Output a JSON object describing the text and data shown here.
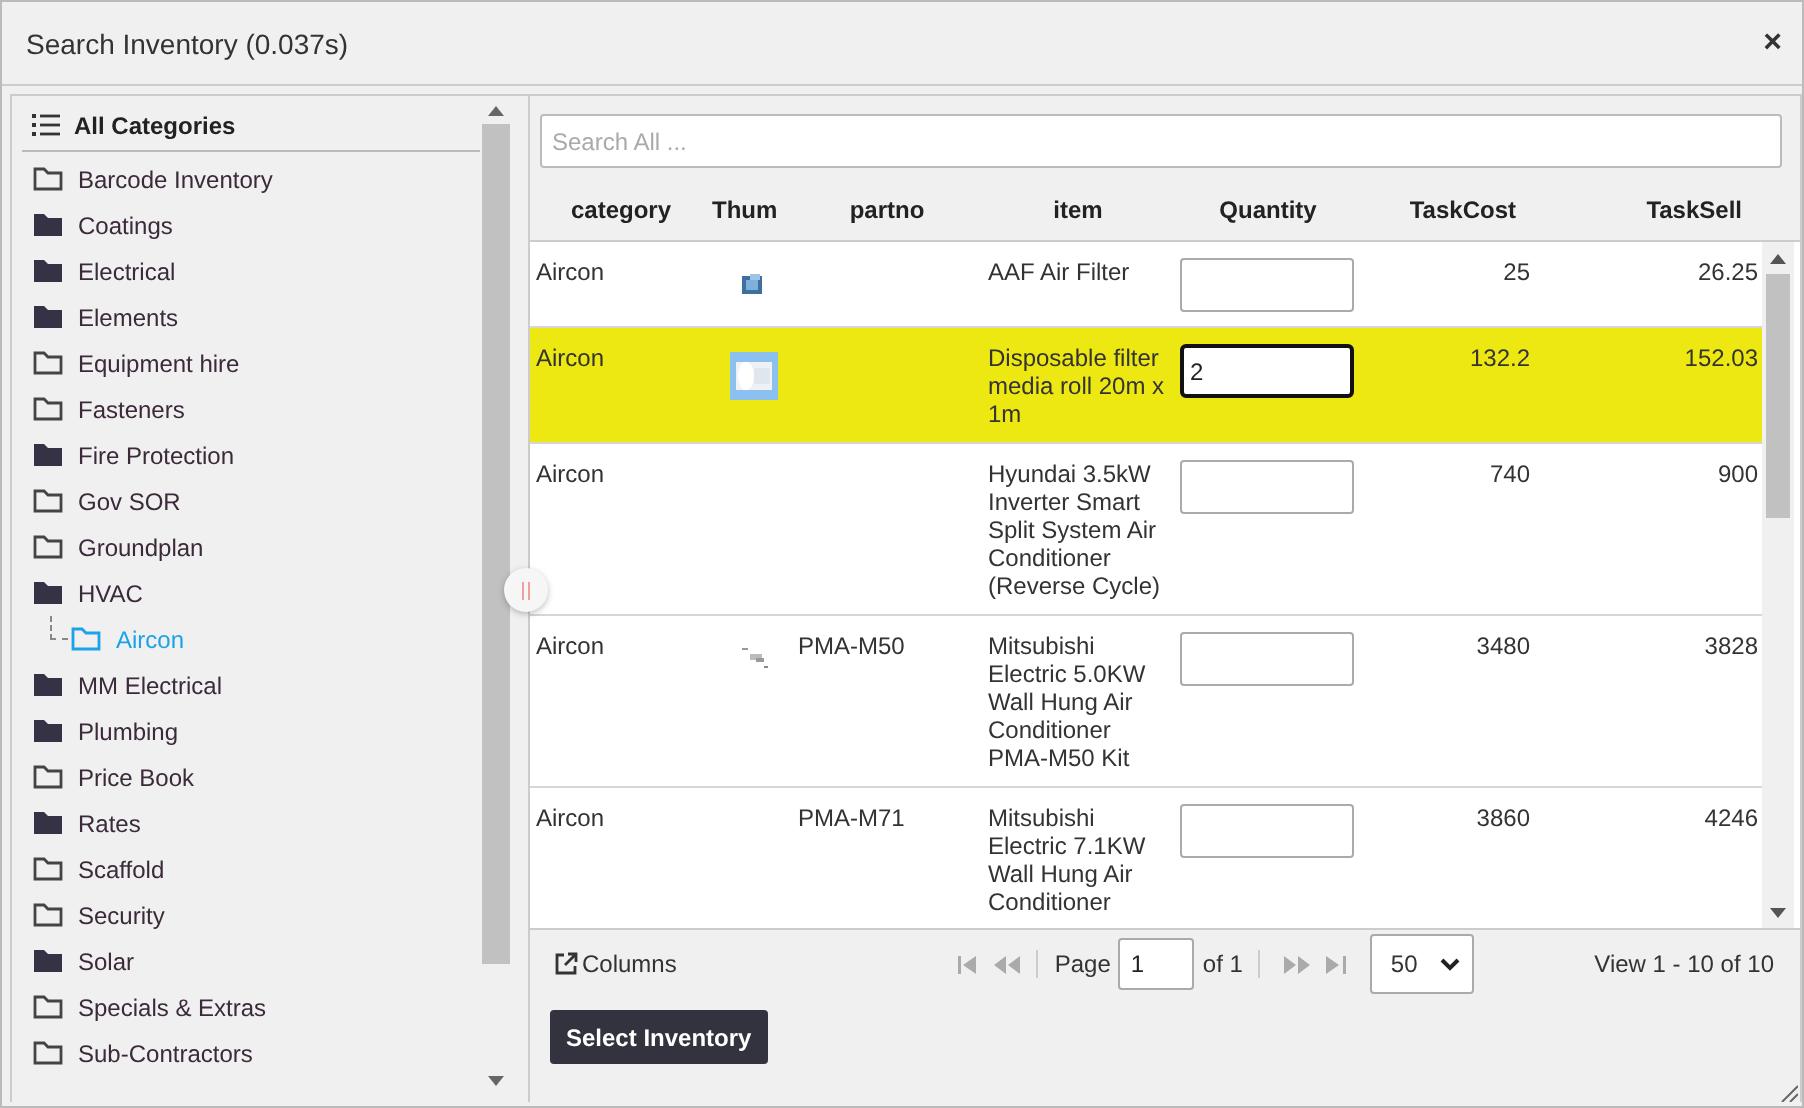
{
  "window": {
    "title": "Search Inventory (0.037s)",
    "close": "×"
  },
  "sidebar": {
    "header": "All Categories",
    "items": [
      {
        "label": "Barcode Inventory",
        "kind": "outline",
        "selected": false
      },
      {
        "label": "Coatings",
        "kind": "filled",
        "selected": false
      },
      {
        "label": "Electrical",
        "kind": "filled",
        "selected": false
      },
      {
        "label": "Elements",
        "kind": "filled",
        "selected": false
      },
      {
        "label": "Equipment hire",
        "kind": "outline",
        "selected": false
      },
      {
        "label": "Fasteners",
        "kind": "outline",
        "selected": false
      },
      {
        "label": "Fire Protection",
        "kind": "filled",
        "selected": false
      },
      {
        "label": "Gov SOR",
        "kind": "outline",
        "selected": false
      },
      {
        "label": "Groundplan",
        "kind": "outline",
        "selected": false
      },
      {
        "label": "HVAC",
        "kind": "filled",
        "selected": false,
        "children": [
          {
            "label": "Aircon",
            "kind": "outline",
            "selected": true
          }
        ]
      },
      {
        "label": "MM Electrical",
        "kind": "filled",
        "selected": false
      },
      {
        "label": "Plumbing",
        "kind": "filled",
        "selected": false
      },
      {
        "label": "Price Book",
        "kind": "outline",
        "selected": false
      },
      {
        "label": "Rates",
        "kind": "filled",
        "selected": false
      },
      {
        "label": "Scaffold",
        "kind": "outline",
        "selected": false
      },
      {
        "label": "Security",
        "kind": "outline",
        "selected": false
      },
      {
        "label": "Solar",
        "kind": "filled",
        "selected": false
      },
      {
        "label": "Specials & Extras",
        "kind": "outline",
        "selected": false
      },
      {
        "label": "Sub-Contractors",
        "kind": "outline",
        "selected": false
      }
    ]
  },
  "search": {
    "placeholder": "Search All ..."
  },
  "table": {
    "columns": [
      "category",
      "Thum",
      "partno",
      "item",
      "Quantity",
      "TaskCost",
      "TaskSell"
    ],
    "rows": [
      {
        "category": "Aircon",
        "partno": "",
        "item": "AAF Air Filter",
        "quantity": "",
        "task_cost": "25",
        "task_sell": "26.25",
        "selected": false
      },
      {
        "category": "Aircon",
        "partno": "",
        "item": "Disposable filter media roll 20m x 1m",
        "quantity": "2",
        "task_cost": "132.2",
        "task_sell": "152.03",
        "selected": true
      },
      {
        "category": "Aircon",
        "partno": "",
        "item": "Hyundai 3.5kW Inverter Smart Split System Air Conditioner (Reverse Cycle)",
        "quantity": "",
        "task_cost": "740",
        "task_sell": "900",
        "selected": false
      },
      {
        "category": "Aircon",
        "partno": "PMA-M50",
        "item": "Mitsubishi Electric 5.0KW Wall Hung Air Conditioner PMA-M50 Kit",
        "quantity": "",
        "task_cost": "3480",
        "task_sell": "3828",
        "selected": false
      },
      {
        "category": "Aircon",
        "partno": "PMA-M71",
        "item": "Mitsubishi Electric 7.1KW Wall Hung Air Conditioner",
        "quantity": "",
        "task_cost": "3860",
        "task_sell": "4246",
        "selected": false
      }
    ]
  },
  "pager": {
    "columns_button": "Columns",
    "page_label": "Page",
    "page": "1",
    "of_label": "of 1",
    "page_size": "50",
    "summary": "View 1 - 10 of 10"
  },
  "buttons": [
    "Select Inventory"
  ]
}
